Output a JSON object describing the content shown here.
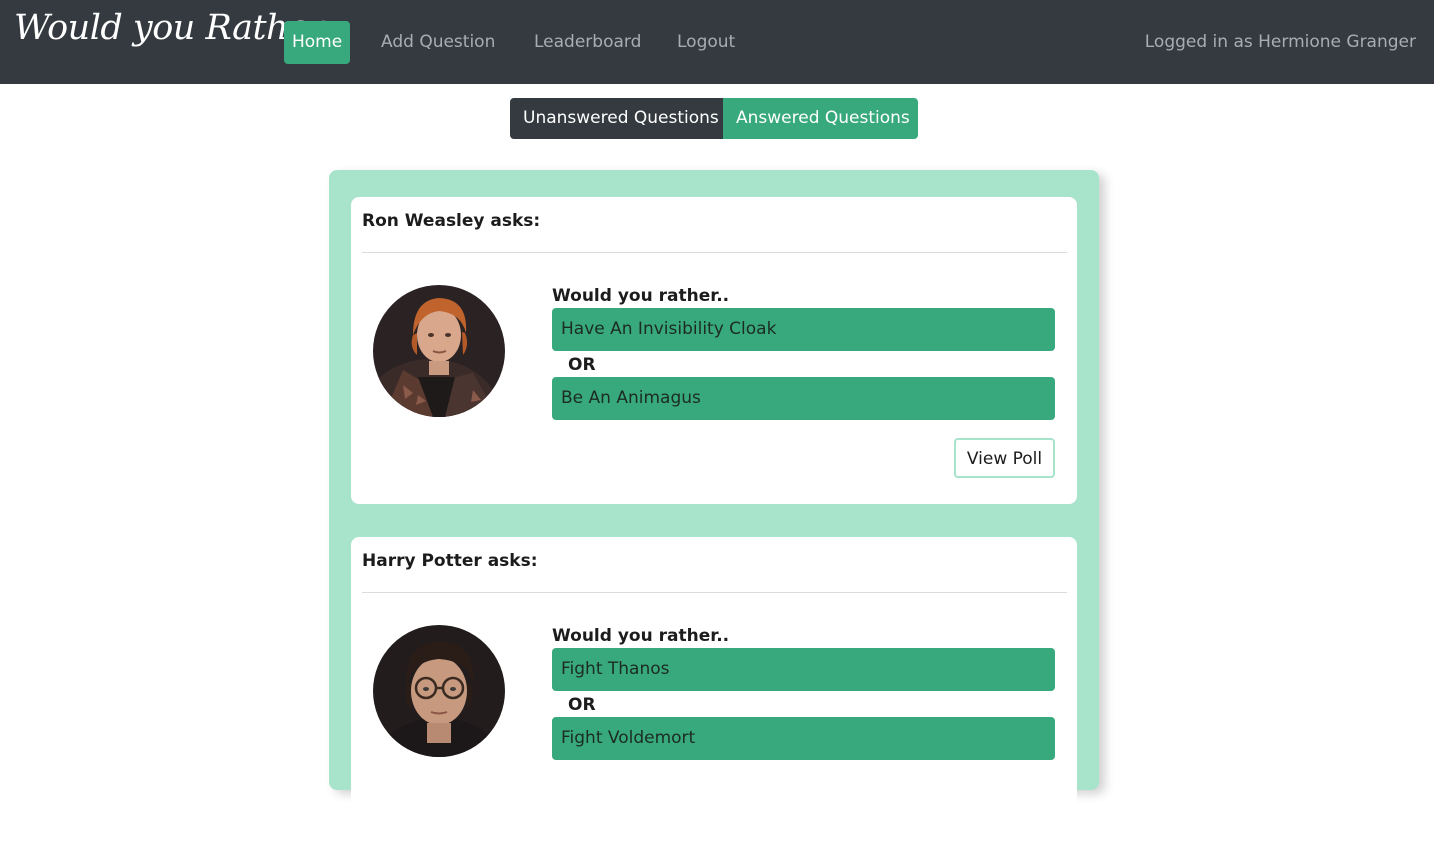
{
  "navbar": {
    "brand": "Would you Rather",
    "links": [
      "Home",
      "Add Question",
      "Leaderboard",
      "Logout"
    ],
    "user_text": "Logged in as Hermione Granger",
    "accent_color": "#38a97d",
    "background_color": "#343a40"
  },
  "toggle": {
    "unanswered": "Unanswered Questions",
    "answered": "Answered Questions"
  },
  "questions": [
    {
      "author_heading": "Ron Weasley asks:",
      "prompt": "Would you rather..",
      "option_one": "Have An Invisibility Cloak",
      "or_text": "OR",
      "option_two": "Be An Animagus",
      "button_label": "View Poll"
    },
    {
      "author_heading": "Harry Potter asks:",
      "prompt": "Would you rather..",
      "option_one": "Fight Thanos",
      "or_text": "OR",
      "option_two": "Fight Voldemort"
    }
  ]
}
